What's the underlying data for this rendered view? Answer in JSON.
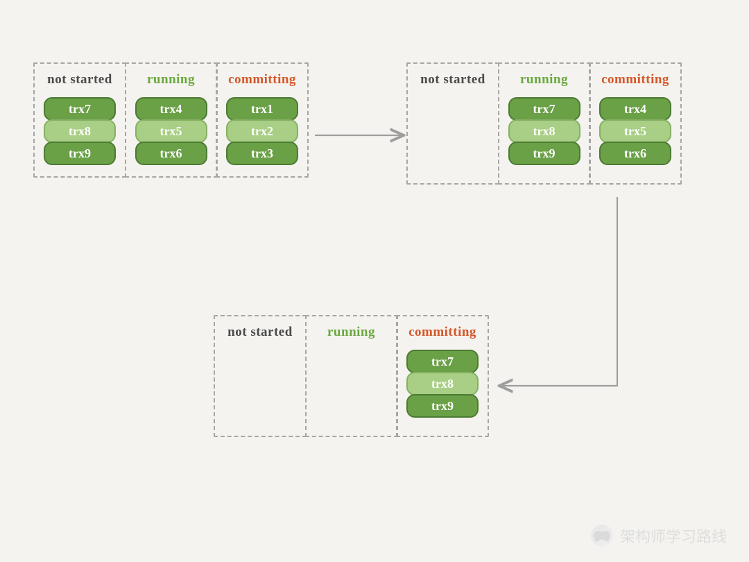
{
  "labels": {
    "not_started": "not started",
    "running": "running",
    "committing": "committing"
  },
  "stages": [
    {
      "id": "stage-1",
      "columns": [
        {
          "state": "not_started",
          "items": [
            "trx7",
            "trx8",
            "trx9"
          ]
        },
        {
          "state": "running",
          "items": [
            "trx4",
            "trx5",
            "trx6"
          ]
        },
        {
          "state": "committing",
          "items": [
            "trx1",
            "trx2",
            "trx3"
          ]
        }
      ]
    },
    {
      "id": "stage-2",
      "columns": [
        {
          "state": "not_started",
          "items": []
        },
        {
          "state": "running",
          "items": [
            "trx7",
            "trx8",
            "trx9"
          ]
        },
        {
          "state": "committing",
          "items": [
            "trx4",
            "trx5",
            "trx6"
          ]
        }
      ]
    },
    {
      "id": "stage-3",
      "columns": [
        {
          "state": "not_started",
          "items": []
        },
        {
          "state": "running",
          "items": []
        },
        {
          "state": "committing",
          "items": [
            "trx7",
            "trx8",
            "trx9"
          ]
        }
      ]
    }
  ],
  "watermark": {
    "text": "架构师学习路线",
    "icon": "wechat-icon"
  }
}
